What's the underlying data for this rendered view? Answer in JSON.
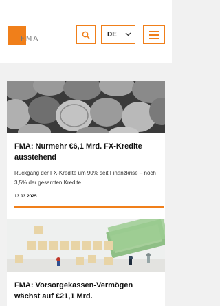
{
  "header": {
    "logo_text": "FMA",
    "language": "DE",
    "accent_color": "#f07f1a",
    "icons": {
      "search": "search-icon",
      "language_chevron": "chevron-down-icon",
      "menu": "hamburger-menu-icon"
    }
  },
  "news": [
    {
      "title": "FMA: Nurmehr €6,1 Mrd. FX-Kredite ausstehend",
      "teaser": "Rückgang der FX-Kredite um 90% seit Finanzkrise – noch 3,5% der gesamten Kredite.",
      "date": "13.03.2025",
      "image": "coins-photo"
    },
    {
      "title": "FMA: Vorsorgekassen-Vermögen wächst auf €21,1 Mrd.",
      "teaser": "",
      "date": "",
      "image": "vorsorge-tiles-photo"
    }
  ]
}
